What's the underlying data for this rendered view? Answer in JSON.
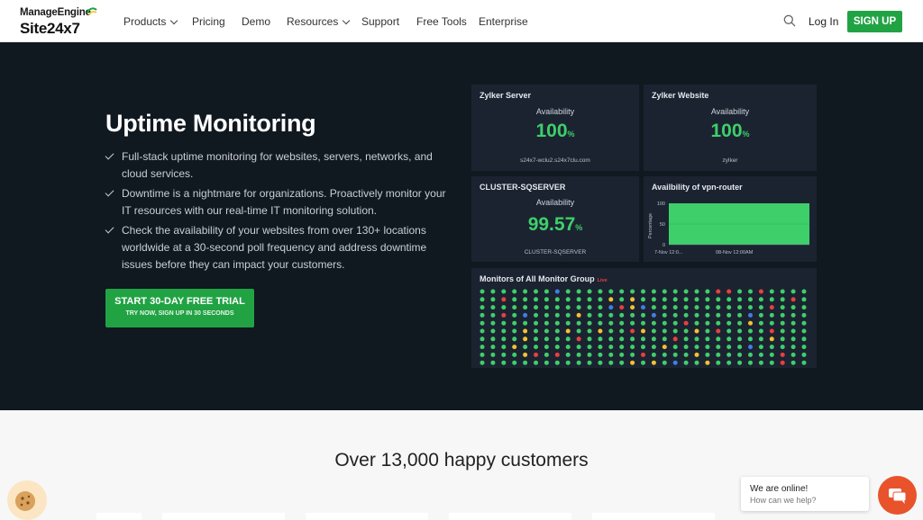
{
  "header": {
    "brand_top": "ManageEngine",
    "brand_bottom": "Site24x7",
    "nav": [
      {
        "label": "Products",
        "has_caret": true
      },
      {
        "label": "Pricing",
        "has_caret": false
      },
      {
        "label": "Demo",
        "has_caret": false
      },
      {
        "label": "Resources",
        "has_caret": true
      },
      {
        "label": "Support",
        "has_caret": false
      },
      {
        "label": "Free Tools",
        "has_caret": false
      },
      {
        "label": "Enterprise",
        "has_caret": false
      }
    ],
    "search_icon": "search-icon",
    "login_label": "Log In",
    "signup_label": "SIGN UP"
  },
  "hero": {
    "title": "Uptime Monitoring",
    "bullets": [
      "Full-stack uptime monitoring for websites, servers, networks, and cloud services.",
      "Downtime is a nightmare for organizations. Proactively monitor your IT resources with our real-time IT monitoring solution.",
      "Check the availability of your websites from over 130+ locations worldwide at a 30-second poll frequency and address downtime issues before they can impact your customers."
    ],
    "cta_label": "START 30-DAY FREE TRIAL",
    "cta_sub": "TRY NOW, SIGN UP IN 30 SECONDS"
  },
  "dashboard": {
    "server": {
      "title": "Zylker Server",
      "label": "Availability",
      "value": "100",
      "unit": "%",
      "host": "s24x7-wclu2.s24x7clu.com"
    },
    "website": {
      "title": "Zylker Website",
      "label": "Availability",
      "value": "100",
      "unit": "%",
      "host": "zylker"
    },
    "sql": {
      "title": "CLUSTER-SQSERVER",
      "label": "Availability",
      "value": "99.57",
      "unit": "%",
      "host": "CLUSTER-SQSERVER"
    },
    "vpn": {
      "title": "Availbility of vpn-router",
      "ylabel": "Percentage",
      "yticks": [
        "100",
        "50",
        "0"
      ],
      "xticks": [
        "7-Nov 12:0...",
        "08-Nov 12:00AM"
      ]
    },
    "monitors": {
      "title": "Monitors of All Monitor Group",
      "live_label": "Live",
      "rows": 10,
      "cols": 31
    }
  },
  "chart_data": {
    "type": "area",
    "title": "Availbility of vpn-router",
    "xlabel": "",
    "ylabel": "Percentage",
    "ylim": [
      0,
      100
    ],
    "x": [
      "7-Nov 12:0...",
      "08-Nov 12:00AM"
    ],
    "series": [
      {
        "values": [
          100,
          100
        ]
      }
    ]
  },
  "customers": {
    "heading": "Over 13,000 happy customers"
  },
  "chat": {
    "title": "We are online!",
    "subtitle": "How can we help?"
  },
  "colors": {
    "accent": "#21a344",
    "hero_bg": "#101820",
    "card_bg": "#1b2330",
    "status_up": "#3ecf6b",
    "status_down": "#e84040",
    "status_trouble": "#f2c230",
    "status_maintenance": "#3f7ee8",
    "chat": "#e8532c"
  }
}
